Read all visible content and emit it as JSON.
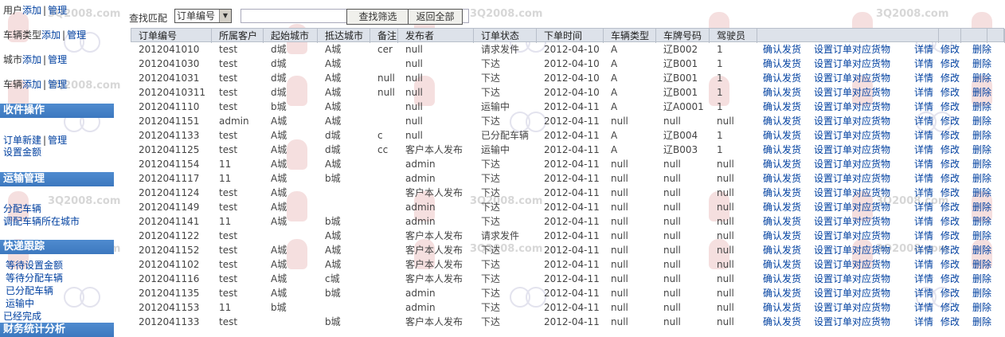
{
  "watermark": "3Q2008.com",
  "colors": {
    "link": "#0040a0",
    "section_header_bg": "#4f8bcf",
    "table_header_bg": "#dde2ea"
  },
  "sidebar": {
    "user": {
      "label": "用户",
      "add": "添加",
      "sep": "|",
      "manage": "管理"
    },
    "vehicle_type": {
      "label": "车辆类型",
      "add": "添加",
      "sep": "|",
      "manage": "管理"
    },
    "city": {
      "label": "城市",
      "add": "添加",
      "sep": "|",
      "manage": "管理"
    },
    "vehicle": {
      "label": "车辆",
      "add": "添加",
      "sep": "|",
      "manage": "管理"
    },
    "section_receive": "收件操作",
    "order_new": "订单新建",
    "order_sep": "|",
    "order_manage": "管理",
    "set_amount": "设置金额",
    "section_transport": "运输管理",
    "assign_vehicle": "分配车辆",
    "adjust_city": "调配车辆所在城市",
    "section_tracking": "快递跟踪",
    "wait_amount": "等待设置金额",
    "wait_assign": "等待分配车辆",
    "assigned": "已分配车辆",
    "in_transit": "运输中",
    "done": "已经完成",
    "section_finance": "财务统计分析"
  },
  "search": {
    "label": "查找匹配",
    "field_selected": "订单编号",
    "value": "",
    "search_button": "查找筛选",
    "reset_button": "返回全部"
  },
  "table": {
    "columns": [
      "订单编号",
      "所属客户",
      "起始城市",
      "抵达城市",
      "备注",
      "发布者",
      "订单状态",
      "下单时间",
      "车辆类型",
      "车牌号码",
      "驾驶员"
    ],
    "action_labels": {
      "confirm": "确认发货",
      "set_goods": "设置订单对应货物",
      "detail": "详情",
      "edit": "修改",
      "delete": "删除"
    },
    "rows": [
      [
        "2012041010",
        "test",
        "d城",
        "A城",
        "cer",
        "null",
        "请求发件",
        "2012-04-10",
        "A",
        "辽B002",
        "1"
      ],
      [
        "2012041030",
        "test",
        "d城",
        "A城",
        "",
        "null",
        "下达",
        "2012-04-10",
        "A",
        "辽B001",
        "1"
      ],
      [
        "2012041031",
        "test",
        "d城",
        "A城",
        "null",
        "null",
        "下达",
        "2012-04-10",
        "A",
        "辽B001",
        "1"
      ],
      [
        "20120410311",
        "test",
        "d城",
        "A城",
        "null",
        "null",
        "下达",
        "2012-04-10",
        "A",
        "辽B001",
        "1"
      ],
      [
        "2012041110",
        "test",
        "b城",
        "A城",
        "",
        "null",
        "运输中",
        "2012-04-11",
        "A",
        "辽A0001",
        "1"
      ],
      [
        "2012041151",
        "admin",
        "A城",
        "A城",
        "",
        "null",
        "下达",
        "2012-04-11",
        "null",
        "null",
        "null"
      ],
      [
        "2012041133",
        "test",
        "A城",
        "d城",
        "c",
        "null",
        "已分配车辆",
        "2012-04-11",
        "A",
        "辽B004",
        "1"
      ],
      [
        "2012041125",
        "test",
        "A城",
        "d城",
        "cc",
        "客户本人发布",
        "运输中",
        "2012-04-11",
        "A",
        "辽B003",
        "1"
      ],
      [
        "2012041154",
        "11",
        "A城",
        "A城",
        "",
        "admin",
        "下达",
        "2012-04-11",
        "null",
        "null",
        "null"
      ],
      [
        "2012041117",
        "11",
        "A城",
        "b城",
        "",
        "admin",
        "下达",
        "2012-04-11",
        "null",
        "null",
        "null"
      ],
      [
        "2012041124",
        "test",
        "A城",
        "",
        "",
        "客户本人发布",
        "下达",
        "2012-04-11",
        "null",
        "null",
        "null"
      ],
      [
        "2012041149",
        "test",
        "A城",
        "",
        "",
        "admin",
        "下达",
        "2012-04-11",
        "null",
        "null",
        "null"
      ],
      [
        "2012041141",
        "11",
        "A城",
        "b城",
        "",
        "admin",
        "下达",
        "2012-04-11",
        "null",
        "null",
        "null"
      ],
      [
        "2012041122",
        "test",
        "",
        "A城",
        "",
        "客户本人发布",
        "请求发件",
        "2012-04-11",
        "null",
        "null",
        "null"
      ],
      [
        "2012041152",
        "test",
        "A城",
        "A城",
        "",
        "客户本人发布",
        "下达",
        "2012-04-11",
        "null",
        "null",
        "null"
      ],
      [
        "2012041102",
        "test",
        "A城",
        "A城",
        "",
        "客户本人发布",
        "下达",
        "2012-04-11",
        "null",
        "null",
        "null"
      ],
      [
        "2012041116",
        "test",
        "A城",
        "c城",
        "",
        "客户本人发布",
        "下达",
        "2012-04-11",
        "null",
        "null",
        "null"
      ],
      [
        "2012041135",
        "test",
        "A城",
        "b城",
        "",
        "admin",
        "下达",
        "2012-04-11",
        "null",
        "null",
        "null"
      ],
      [
        "2012041153",
        "11",
        "b城",
        "",
        "",
        "admin",
        "下达",
        "2012-04-11",
        "null",
        "null",
        "null"
      ],
      [
        "2012041133",
        "test",
        "",
        "b城",
        "",
        "客户本人发布",
        "下达",
        "2012-04-11",
        "null",
        "null",
        "null"
      ]
    ]
  }
}
